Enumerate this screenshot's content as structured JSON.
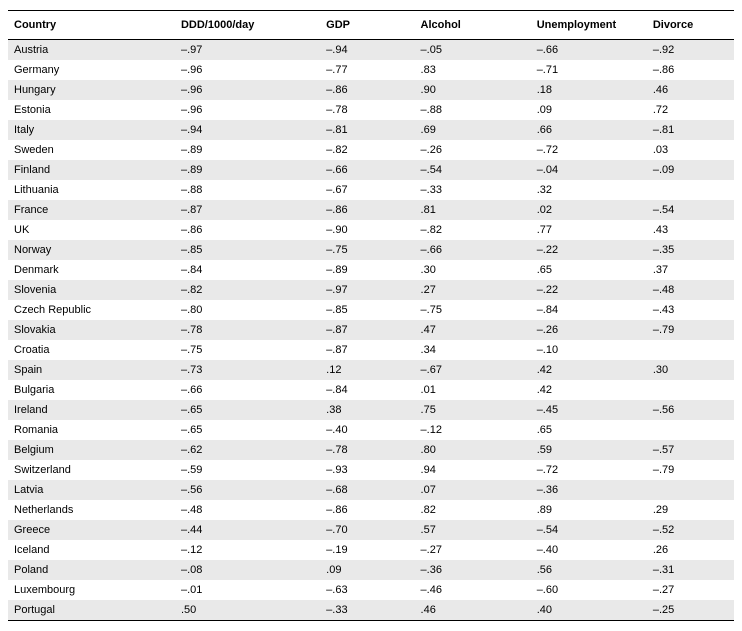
{
  "chart_data": {
    "type": "table",
    "columns": [
      "Country",
      "DDD/1000/day",
      "GDP",
      "Alcohol",
      "Unemployment",
      "Divorce"
    ],
    "rows": [
      {
        "country": "Austria",
        "ddd": "–.97",
        "gdp": "–.94",
        "alcohol": "–.05",
        "unemployment": "–.66",
        "divorce": "–.92"
      },
      {
        "country": "Germany",
        "ddd": "–.96",
        "gdp": "–.77",
        "alcohol": ".83",
        "unemployment": "–.71",
        "divorce": "–.86"
      },
      {
        "country": "Hungary",
        "ddd": "–.96",
        "gdp": "–.86",
        "alcohol": ".90",
        "unemployment": ".18",
        "divorce": ".46"
      },
      {
        "country": "Estonia",
        "ddd": "–.96",
        "gdp": "–.78",
        "alcohol": "–.88",
        "unemployment": ".09",
        "divorce": ".72"
      },
      {
        "country": "Italy",
        "ddd": "–.94",
        "gdp": "–.81",
        "alcohol": ".69",
        "unemployment": ".66",
        "divorce": "–.81"
      },
      {
        "country": "Sweden",
        "ddd": "–.89",
        "gdp": "–.82",
        "alcohol": "–.26",
        "unemployment": "–.72",
        "divorce": ".03"
      },
      {
        "country": "Finland",
        "ddd": "–.89",
        "gdp": "–.66",
        "alcohol": "–.54",
        "unemployment": "–.04",
        "divorce": "–.09"
      },
      {
        "country": "Lithuania",
        "ddd": "–.88",
        "gdp": "–.67",
        "alcohol": "–.33",
        "unemployment": ".32",
        "divorce": ""
      },
      {
        "country": "France",
        "ddd": "–.87",
        "gdp": "–.86",
        "alcohol": ".81",
        "unemployment": ".02",
        "divorce": "–.54"
      },
      {
        "country": "UK",
        "ddd": "–.86",
        "gdp": "–.90",
        "alcohol": "–.82",
        "unemployment": ".77",
        "divorce": ".43"
      },
      {
        "country": "Norway",
        "ddd": "–.85",
        "gdp": "–.75",
        "alcohol": "–.66",
        "unemployment": "–.22",
        "divorce": "–.35"
      },
      {
        "country": "Denmark",
        "ddd": "–.84",
        "gdp": "–.89",
        "alcohol": ".30",
        "unemployment": ".65",
        "divorce": ".37"
      },
      {
        "country": "Slovenia",
        "ddd": "–.82",
        "gdp": "–.97",
        "alcohol": ".27",
        "unemployment": "–.22",
        "divorce": "–.48"
      },
      {
        "country": "Czech Republic",
        "ddd": "–.80",
        "gdp": "–.85",
        "alcohol": "–.75",
        "unemployment": "–.84",
        "divorce": "–.43"
      },
      {
        "country": "Slovakia",
        "ddd": "–.78",
        "gdp": "–.87",
        "alcohol": ".47",
        "unemployment": "–.26",
        "divorce": "–.79"
      },
      {
        "country": "Croatia",
        "ddd": "–.75",
        "gdp": "–.87",
        "alcohol": ".34",
        "unemployment": "–.10",
        "divorce": ""
      },
      {
        "country": "Spain",
        "ddd": "–.73",
        "gdp": ".12",
        "alcohol": "–.67",
        "unemployment": ".42",
        "divorce": ".30"
      },
      {
        "country": "Bulgaria",
        "ddd": "–.66",
        "gdp": "–.84",
        "alcohol": ".01",
        "unemployment": ".42",
        "divorce": ""
      },
      {
        "country": "Ireland",
        "ddd": "–.65",
        "gdp": ".38",
        "alcohol": ".75",
        "unemployment": "–.45",
        "divorce": "–.56"
      },
      {
        "country": "Romania",
        "ddd": "–.65",
        "gdp": "–.40",
        "alcohol": "–.12",
        "unemployment": ".65",
        "divorce": ""
      },
      {
        "country": "Belgium",
        "ddd": "–.62",
        "gdp": "–.78",
        "alcohol": ".80",
        "unemployment": ".59",
        "divorce": "–.57"
      },
      {
        "country": "Switzerland",
        "ddd": "–.59",
        "gdp": "–.93",
        "alcohol": ".94",
        "unemployment": "–.72",
        "divorce": "–.79"
      },
      {
        "country": "Latvia",
        "ddd": "–.56",
        "gdp": "–.68",
        "alcohol": ".07",
        "unemployment": "–.36",
        "divorce": ""
      },
      {
        "country": "Netherlands",
        "ddd": "–.48",
        "gdp": "–.86",
        "alcohol": ".82",
        "unemployment": ".89",
        "divorce": ".29"
      },
      {
        "country": "Greece",
        "ddd": "–.44",
        "gdp": "–.70",
        "alcohol": ".57",
        "unemployment": "–.54",
        "divorce": "–.52"
      },
      {
        "country": "Iceland",
        "ddd": "–.12",
        "gdp": "–.19",
        "alcohol": "–.27",
        "unemployment": "–.40",
        "divorce": ".26"
      },
      {
        "country": "Poland",
        "ddd": "–.08",
        "gdp": ".09",
        "alcohol": "–.36",
        "unemployment": ".56",
        "divorce": "–.31"
      },
      {
        "country": "Luxembourg",
        "ddd": "–.01",
        "gdp": "–.63",
        "alcohol": "–.46",
        "unemployment": "–.60",
        "divorce": "–.27"
      },
      {
        "country": "Portugal",
        "ddd": ".50",
        "gdp": "–.33",
        "alcohol": ".46",
        "unemployment": ".40",
        "divorce": "–.25"
      }
    ]
  }
}
